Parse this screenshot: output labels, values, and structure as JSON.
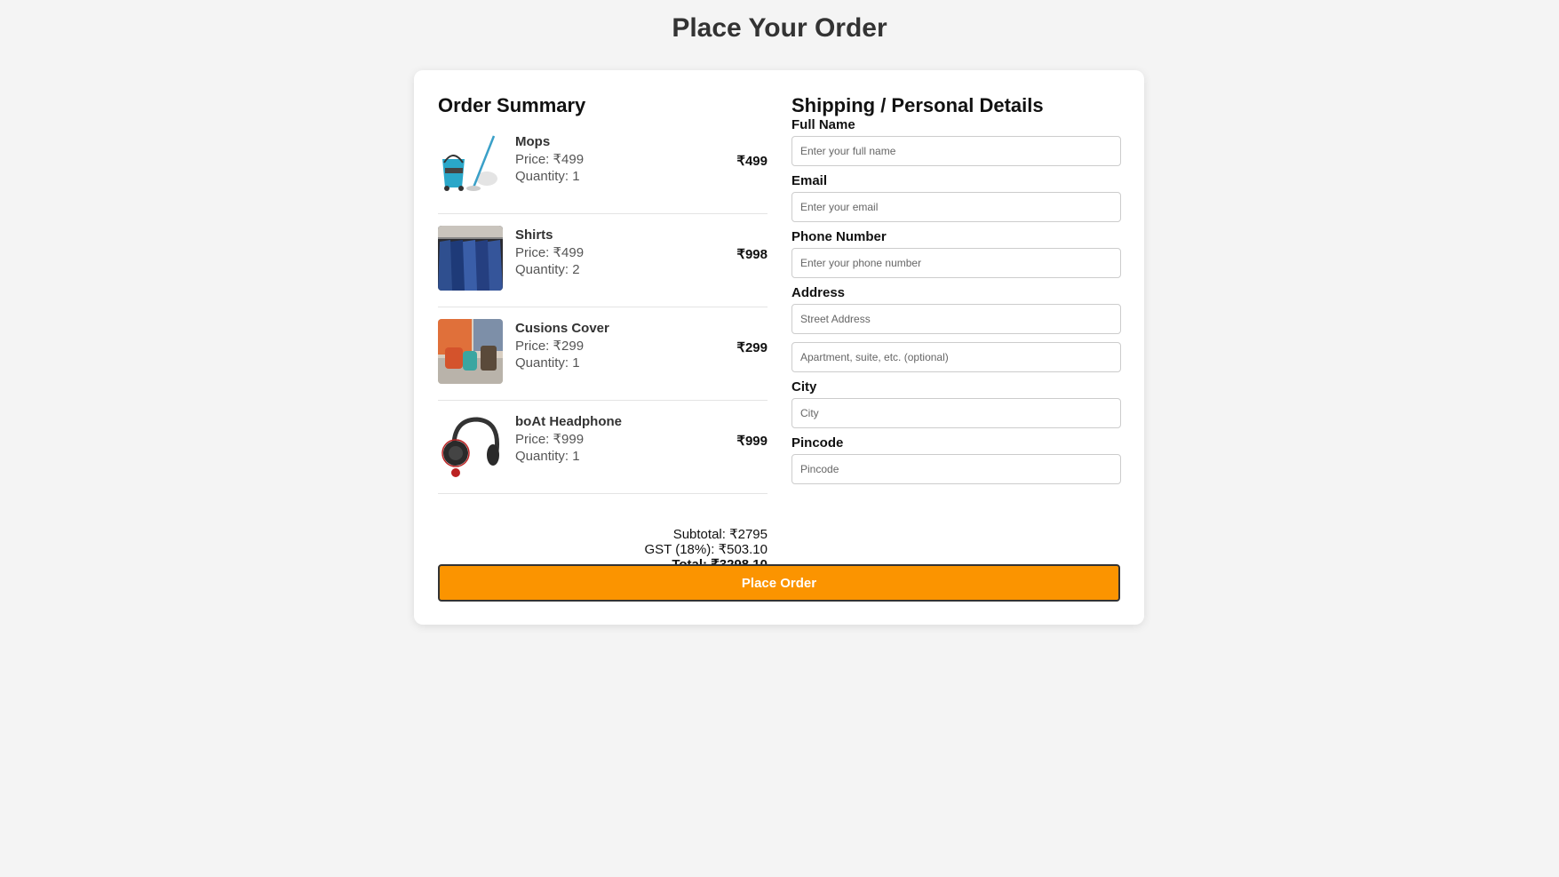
{
  "page": {
    "title": "Place Your Order"
  },
  "summary": {
    "heading": "Order Summary",
    "items": [
      {
        "name": "Mops",
        "price": "Price: ₹499",
        "quantity": "Quantity: 1",
        "total": "₹499",
        "icon": "mop-bucket-image"
      },
      {
        "name": "Shirts",
        "price": "Price: ₹499",
        "quantity": "Quantity: 2",
        "total": "₹998",
        "icon": "shirts-image"
      },
      {
        "name": "Cusions Cover",
        "price": "Price: ₹299",
        "quantity": "Quantity: 1",
        "total": "₹299",
        "icon": "cushion-cover-image"
      },
      {
        "name": "boAt Headphone",
        "price": "Price: ₹999",
        "quantity": "Quantity: 1",
        "total": "₹999",
        "icon": "headphone-image"
      }
    ],
    "subtotal": "Subtotal: ₹2795",
    "gst": "GST (18%): ₹503.10",
    "total": "Total: ₹3298.10"
  },
  "shipping": {
    "heading": "Shipping / Personal Details",
    "full_name": {
      "label": "Full Name",
      "placeholder": "Enter your full name"
    },
    "email": {
      "label": "Email",
      "placeholder": "Enter your email"
    },
    "phone": {
      "label": "Phone Number",
      "placeholder": "Enter your phone number"
    },
    "address": {
      "label": "Address",
      "placeholder": "Street Address",
      "placeholder2": "Apartment, suite, etc. (optional)"
    },
    "city": {
      "label": "City",
      "placeholder": "City"
    },
    "pincode": {
      "label": "Pincode",
      "placeholder": "Pincode"
    }
  },
  "actions": {
    "place_order": "Place Order"
  },
  "colors": {
    "accent": "#fb9400",
    "background": "#f4f4f4",
    "card": "#ffffff"
  }
}
